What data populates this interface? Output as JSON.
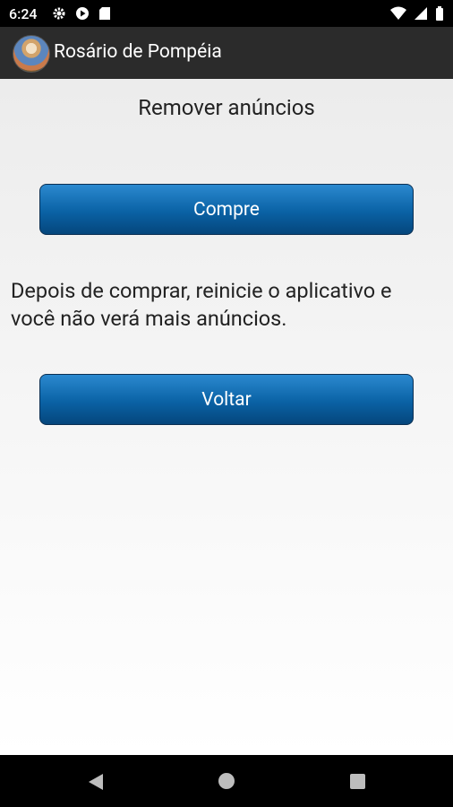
{
  "status_bar": {
    "time": "6:24"
  },
  "app_bar": {
    "title": "Rosário de Pompéia"
  },
  "page": {
    "title": "Remover anúncios",
    "buy_button": "Compre",
    "info_text": "Depois de comprar, reinicie o aplicativo e você não verá mais anúncios.",
    "back_button": "Voltar"
  }
}
